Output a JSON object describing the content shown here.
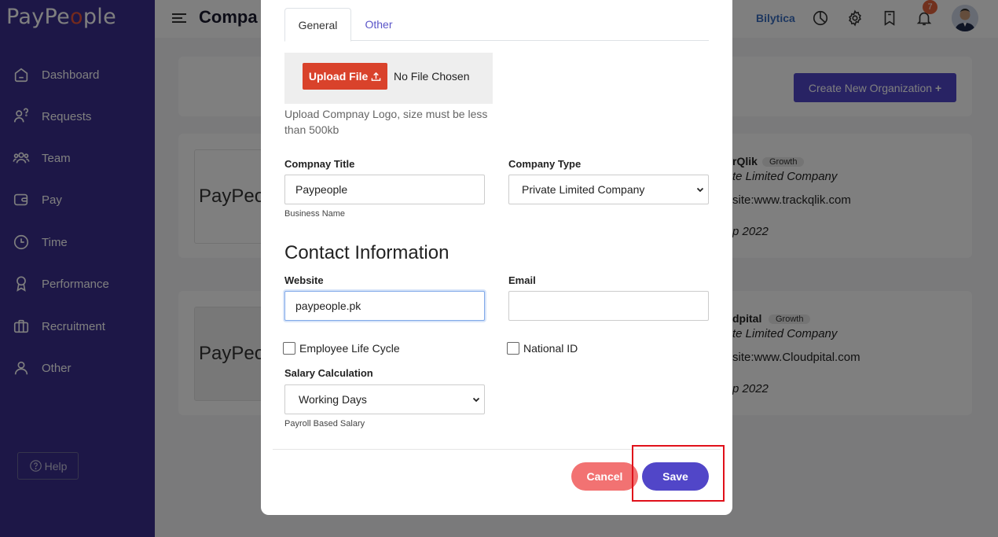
{
  "app": {
    "logo_text_a": "PayPe",
    "logo_text_o": "o",
    "logo_text_b": "ple"
  },
  "sidebar": {
    "items": [
      {
        "label": "Dashboard",
        "icon": "home-icon"
      },
      {
        "label": "Requests",
        "icon": "user-question-icon"
      },
      {
        "label": "Team",
        "icon": "team-icon"
      },
      {
        "label": "Pay",
        "icon": "wallet-icon"
      },
      {
        "label": "Time",
        "icon": "clock-icon"
      },
      {
        "label": "Performance",
        "icon": "award-icon"
      },
      {
        "label": "Recruitment",
        "icon": "briefcase-icon"
      },
      {
        "label": "Other",
        "icon": "user-icon"
      }
    ],
    "help_label": "Help"
  },
  "header": {
    "title": "Compa",
    "brand": "Bilytica",
    "notification_count": "7"
  },
  "main": {
    "create_button": "Create New Organization",
    "orgs": [
      {
        "logo_text": "PayPeople",
        "name": "rQlik",
        "badge": "Growth",
        "type": "te Limited Company",
        "site": "site:www.trackqlik.com",
        "date": "p 2022"
      },
      {
        "logo_text": "PayPeople",
        "name": "dpital",
        "badge": "Growth",
        "type": "te Limited Company",
        "site": "site:www.Cloudpital.com",
        "date": "p 2022"
      }
    ]
  },
  "modal": {
    "tabs": [
      "General",
      "Other"
    ],
    "upload_button": "Upload File",
    "no_file": "No File Chosen",
    "upload_hint": "Upload Compnay Logo, size must be less than 500kb",
    "company_title_label": "Compnay Title",
    "company_title_value": "Paypeople",
    "company_title_hint": "Business Name",
    "company_type_label": "Company Type",
    "company_type_value": "Private Limited Company",
    "section_title": "Contact Information",
    "website_label": "Website",
    "website_value": "paypeople.pk",
    "email_label": "Email",
    "email_value": "",
    "checkbox_lifecycle": "Employee Life Cycle",
    "checkbox_national_id": "National ID",
    "salary_label": "Salary Calculation",
    "salary_value": "Working Days",
    "salary_hint": "Payroll Based Salary",
    "cancel_label": "Cancel",
    "save_label": "Save"
  }
}
